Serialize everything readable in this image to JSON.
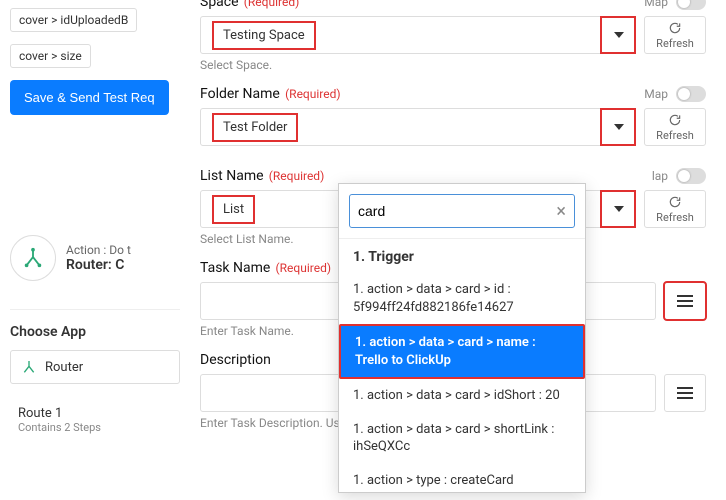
{
  "left": {
    "pill1": "cover > idUploadedB",
    "pill2": "cover > size",
    "save_btn": "Save & Send Test Req",
    "node_sub": "Action : Do t",
    "node_main": "Router: C",
    "choose_app_heading": "Choose App",
    "app_name": "Router",
    "route_title": "Route 1",
    "route_sub": "Contains 2 Steps"
  },
  "fields": {
    "space": {
      "label": "Space",
      "required": "(Required)",
      "value": "Testing Space",
      "map": "Map",
      "refresh": "Refresh",
      "helper": "Select Space."
    },
    "folder": {
      "label": "Folder Name",
      "required": "(Required)",
      "value": "Test Folder",
      "map": "Map",
      "refresh": "Refresh",
      "helper": ""
    },
    "list": {
      "label": "List Name",
      "required": "(Required)",
      "value": "List",
      "map": "lap",
      "refresh": "Refresh",
      "helper": "Select List Name."
    },
    "task": {
      "label": "Task Name",
      "required": "(Required)",
      "helper": "Enter Task Name."
    },
    "desc": {
      "label": "Description",
      "helper": "Enter Task Description. Us"
    }
  },
  "popup": {
    "search_value": "card",
    "heading": "1. Trigger",
    "items": [
      "1. action > data > card > id : 5f994ff24fd882186fe14627",
      "1. action > data > card > name : Trello to ClickUp",
      "1. action > data > card > idShort : 20",
      "1. action > data > card > shortLink : ihSeQXCc",
      "1. action > type : createCard"
    ]
  }
}
